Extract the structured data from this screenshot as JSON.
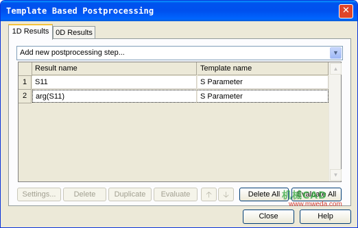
{
  "window": {
    "title": "Template Based Postprocessing",
    "close_glyph": "✕"
  },
  "tabs": [
    {
      "label": "1D Results",
      "active": true
    },
    {
      "label": "0D Results",
      "active": false
    }
  ],
  "step_combo": {
    "value": "Add new postprocessing step...",
    "arrow_icon": "chevron-down-icon"
  },
  "table": {
    "columns": [
      "Result name",
      "Template name"
    ],
    "rows": [
      {
        "num": "1",
        "result": "S11",
        "template": "S Parameter"
      },
      {
        "num": "2",
        "result": "arg(S11)",
        "template": "S Parameter"
      }
    ]
  },
  "buttons": {
    "settings": "Settings...",
    "delete": "Delete",
    "duplicate": "Duplicate",
    "evaluate": "Evaluate",
    "up_icon": "arrow-up-icon",
    "down_icon": "arrow-down-icon",
    "delete_all": "Delete All",
    "evaluate_all": "Evaluate All",
    "close": "Close",
    "help": "Help"
  },
  "watermark": {
    "logo": "机械CAD",
    "url": "www.mweda.com"
  }
}
